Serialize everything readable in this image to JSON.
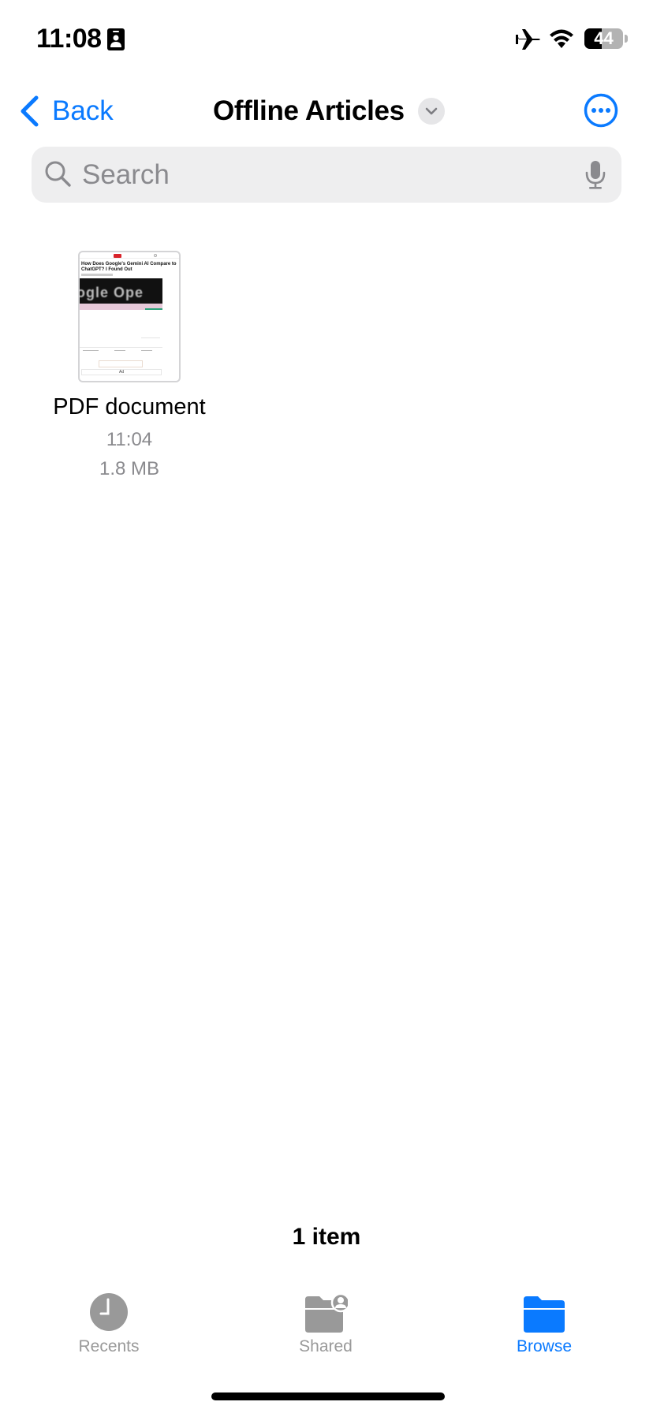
{
  "status_bar": {
    "time": "11:08",
    "battery_level": "44",
    "battery_percent": 44,
    "icons": [
      "contact-card-icon",
      "airplane-mode-icon",
      "wifi-icon",
      "battery-icon"
    ]
  },
  "nav": {
    "back_label": "Back",
    "title": "Offline Articles",
    "icons": {
      "back": "chevron-left-icon",
      "title_menu": "chevron-down-icon",
      "more": "ellipsis-circle-icon"
    }
  },
  "search": {
    "placeholder": "Search",
    "value": "",
    "icons": {
      "search": "magnifier-icon",
      "dictation": "microphone-icon"
    }
  },
  "files": [
    {
      "name": "PDF document",
      "time": "11:04",
      "size": "1.8 MB",
      "thumbnail": {
        "headline": "How Does Google's Gemini AI Compare to ChatGPT? I Found Out",
        "image_text": "ogle  Ope",
        "ad_label": "Ad"
      }
    }
  ],
  "footer": {
    "item_count": "1 item"
  },
  "tabs": [
    {
      "label": "Recents",
      "icon": "clock-icon",
      "active": false
    },
    {
      "label": "Shared",
      "icon": "shared-folder-icon",
      "active": false
    },
    {
      "label": "Browse",
      "icon": "folder-icon",
      "active": true
    }
  ],
  "colors": {
    "accent": "#0a7aff",
    "inactive": "#999999",
    "secondary_text": "#8a8a8e",
    "search_bg": "#eeeeef"
  }
}
